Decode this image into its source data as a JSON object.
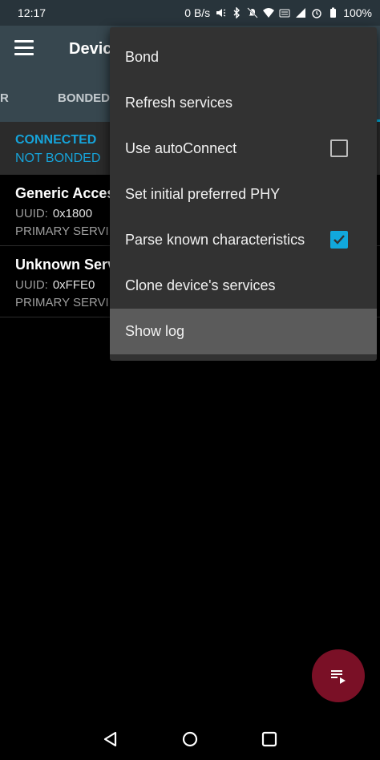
{
  "status_bar": {
    "time": "12:17",
    "net_speed": "0 B/s",
    "battery": "100%",
    "icons": [
      "speaker-icon",
      "bluetooth-icon",
      "mute-icon",
      "wifi-icon",
      "lte-icon",
      "signal-icon",
      "alarm-icon",
      "battery-icon"
    ]
  },
  "toolbar": {
    "title": "Devic",
    "menu_icon": "hamburger-icon"
  },
  "tabs": {
    "items": [
      {
        "label": "R"
      },
      {
        "label": "BONDED"
      }
    ]
  },
  "connection": {
    "state": "CONNECTED",
    "bond": "NOT BONDED"
  },
  "services": [
    {
      "name": "Generic Acces",
      "uuid_label": "UUID:",
      "uuid": "0x1800",
      "type": "PRIMARY SERVI"
    },
    {
      "name": "Unknown Serv",
      "uuid_label": "UUID:",
      "uuid": "0xFFE0",
      "type": "PRIMARY SERVI"
    }
  ],
  "menu": {
    "items": [
      {
        "label": "Bond"
      },
      {
        "label": "Refresh services"
      },
      {
        "label": "Use autoConnect",
        "checkbox": false
      },
      {
        "label": "Set initial preferred PHY"
      },
      {
        "label": "Parse known characteristics",
        "checkbox": true
      },
      {
        "label": "Clone device's services"
      },
      {
        "label": "Show log",
        "highlighted": true
      }
    ]
  },
  "fab": {
    "icon": "log-list-icon",
    "color": "#7a1026"
  },
  "nav_bar": {
    "icons": [
      "back-icon",
      "home-icon",
      "recents-icon"
    ]
  },
  "colors": {
    "accent": "#16a3d9",
    "toolbar": "#37474f",
    "menu_bg": "#323232"
  }
}
